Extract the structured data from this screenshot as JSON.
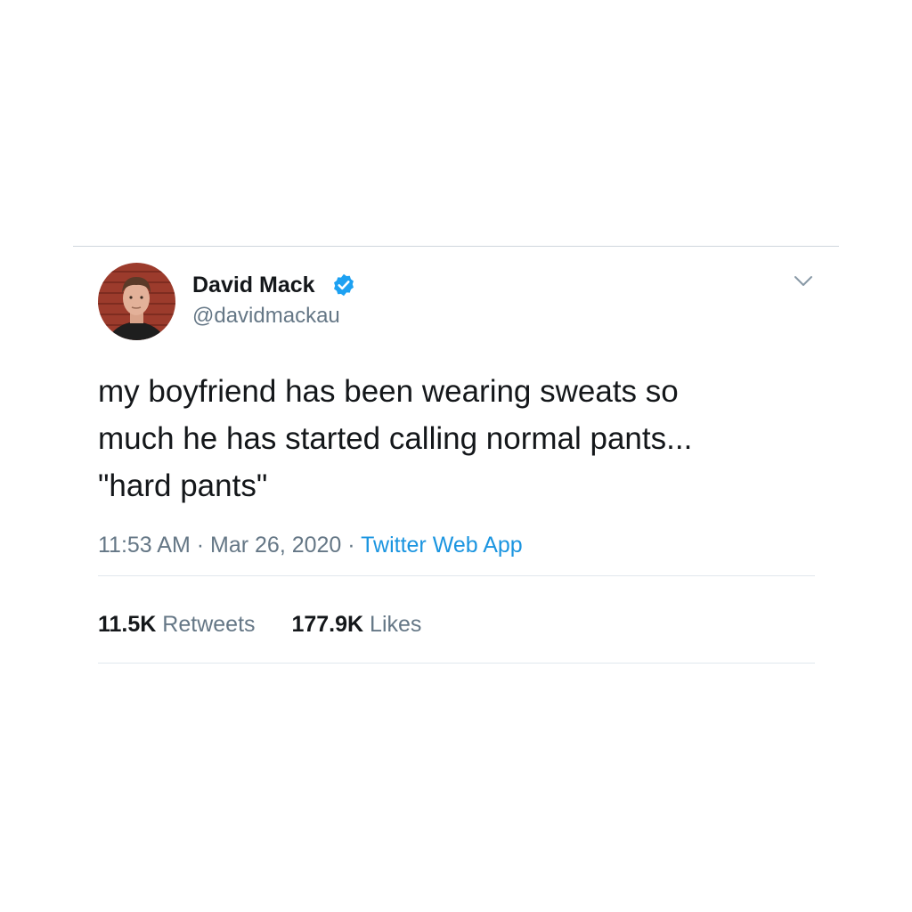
{
  "author": {
    "name": "David Mack",
    "handle": "@davidmackau",
    "verified": true,
    "avatar_icon": "profile-photo"
  },
  "tweet": {
    "text_lines": [
      "my boyfriend has been wearing sweats so",
      "much he has started calling normal pants...",
      "\"hard pants\""
    ]
  },
  "meta": {
    "time": "11:53 AM",
    "separator": "·",
    "date": "Mar 26, 2020",
    "source": "Twitter Web App"
  },
  "stats": {
    "retweets": {
      "count": "11.5K",
      "label": "Retweets"
    },
    "likes": {
      "count": "177.9K",
      "label": "Likes"
    }
  },
  "colors": {
    "text": "#14171a",
    "secondary": "#657786",
    "link": "#1b95e0",
    "verified": "#1da1f2",
    "divider": "#e1e8ed"
  }
}
